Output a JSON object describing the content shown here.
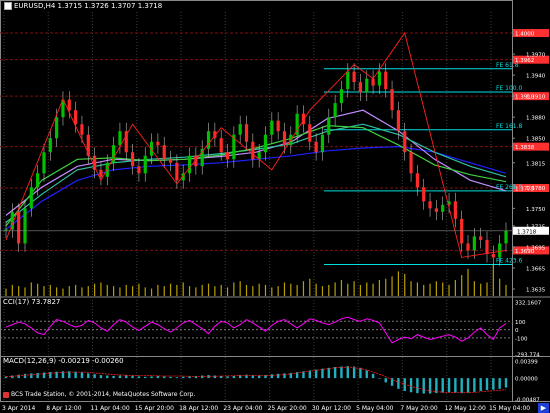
{
  "window": {
    "symbol_header": "EURUSD,H4  1.3715 1.3726 1.3707 1.3718",
    "footer": "BCS Trade Station, © 2001-2014, MetaQuotes Software Corp."
  },
  "icons": {
    "symbol_icon": "chart-icon",
    "footer_icon": "broker-logo-icon",
    "scroll_icon": "arrow-right-icon"
  },
  "colors": {
    "background": "#000000",
    "grid": "#3a3a3a",
    "candle_up": "#00c000",
    "candle_down": "#ff2a2a",
    "fib_lines": "#00e0e0",
    "zigzag": "#ff2020",
    "ma_blue": "#2020ff",
    "ma_violet": "#c08cff",
    "ma_teal": "#30c0a0",
    "ma_green": "#40d040",
    "ma_white": "#e0e0e0",
    "volume": "#b8a000",
    "cci_line": "#ff00ff",
    "macd_hist": "#20b0c0",
    "macd_signal": "#ff2020",
    "price_marker": "#ff3030",
    "current_price_bg": "#ffffff"
  },
  "chart_data": {
    "type": "candlestick",
    "symbol": "EURUSD",
    "timeframe": "H4",
    "ohlc_last": {
      "open": 1.3715,
      "high": 1.3726,
      "low": 1.3707,
      "close": 1.3718
    },
    "current_price": "1.3718",
    "price_axis_ticks": [
      "1.3970",
      "1.3940",
      "1.3910",
      "1.3880",
      "1.3850",
      "1.3815",
      "1.3780",
      "1.3750",
      "1.3725",
      "1.3695",
      "1.3665",
      "1.3635"
    ],
    "price_markers": [
      "1.4000",
      "1.3962",
      "1.3910",
      "1.3838",
      "1.3779",
      "1.3690"
    ],
    "ylim": [
      1.3625,
      1.403
    ],
    "x_ticks": [
      "3 Apr 2014",
      "8 Apr 12:00",
      "11 Apr 04:00",
      "15 Apr 20:00",
      "18 Apr 12:00",
      "23 Apr 04:00",
      "25 Apr 20:00",
      "30 Apr 12:00",
      "5 May 04:00",
      "7 May 20:00",
      "12 May 12:00",
      "15 May 04:00"
    ],
    "fib_levels": [
      {
        "label": "FE 61.8",
        "price": 1.3949
      },
      {
        "label": "FE 100.0",
        "price": 1.3916
      },
      {
        "label": "FE 161.8",
        "price": 1.3862
      },
      {
        "label": "FE 261.8",
        "price": 1.3775
      },
      {
        "label": "FE 423.6",
        "price": 1.367
      }
    ],
    "price_series": [
      1.372,
      1.3745,
      1.37,
      1.375,
      1.378,
      1.38,
      1.383,
      1.385,
      1.388,
      1.3905,
      1.389,
      1.387,
      1.3855,
      1.3825,
      1.3805,
      1.3795,
      1.3815,
      1.384,
      1.386,
      1.383,
      1.381,
      1.38,
      1.3825,
      1.3845,
      1.384,
      1.382,
      1.3815,
      1.379,
      1.38,
      1.3825,
      1.381,
      1.3835,
      1.386,
      1.385,
      1.383,
      1.382,
      1.3855,
      1.387,
      1.3845,
      1.382,
      1.383,
      1.3855,
      1.3875,
      1.386,
      1.384,
      1.3855,
      1.3885,
      1.387,
      1.3845,
      1.383,
      1.3855,
      1.388,
      1.39,
      1.392,
      1.3945,
      1.393,
      1.3915,
      1.3935,
      1.3925,
      1.3945,
      1.392,
      1.389,
      1.386,
      1.383,
      1.38,
      1.378,
      1.376,
      1.375,
      1.3745,
      1.3755,
      1.376,
      1.3735,
      1.37,
      1.369,
      1.371,
      1.3705,
      1.3685,
      1.368,
      1.37,
      1.3718
    ],
    "zigzag": [
      [
        0,
        1.3705
      ],
      [
        9,
        1.3906
      ],
      [
        15,
        1.379
      ],
      [
        20,
        1.387
      ],
      [
        27,
        1.3785
      ],
      [
        34,
        1.3865
      ],
      [
        42,
        1.3805
      ],
      [
        48,
        1.389
      ],
      [
        55,
        1.3955
      ],
      [
        58,
        1.3935
      ],
      [
        63,
        1.4
      ],
      [
        72,
        1.368
      ],
      [
        79,
        1.369
      ]
    ],
    "moving_averages": [
      {
        "color": "#2020ff",
        "values": [
          1.372,
          1.376,
          1.379,
          1.3805,
          1.381,
          1.3812,
          1.3815,
          1.382,
          1.3825,
          1.3832,
          1.3836,
          1.3838,
          1.383,
          1.3815,
          1.38
        ]
      },
      {
        "color": "#c08cff",
        "values": [
          1.374,
          1.378,
          1.381,
          1.382,
          1.3818,
          1.382,
          1.3824,
          1.383,
          1.3845,
          1.3878,
          1.389,
          1.386,
          1.382,
          1.379,
          1.3775
        ]
      },
      {
        "color": "#30c0a0",
        "values": [
          1.373,
          1.377,
          1.3805,
          1.3815,
          1.382,
          1.3823,
          1.3828,
          1.3834,
          1.3842,
          1.386,
          1.387,
          1.3855,
          1.383,
          1.381,
          1.3795
        ]
      },
      {
        "color": "#40d040",
        "values": [
          1.3725,
          1.379,
          1.382,
          1.3822,
          1.3818,
          1.382,
          1.3826,
          1.3836,
          1.385,
          1.3868,
          1.3865,
          1.384,
          1.3812,
          1.3798,
          1.3788
        ]
      }
    ],
    "volume": [
      6,
      9,
      8,
      7,
      11,
      10,
      8,
      9,
      7,
      6,
      8,
      9,
      7,
      8,
      10,
      11,
      9,
      8,
      7,
      9,
      8,
      10,
      7,
      6,
      9,
      8,
      10,
      9,
      11,
      8,
      7,
      9,
      10,
      8,
      9,
      7,
      11,
      12,
      9,
      8,
      10,
      9,
      7,
      8,
      11,
      10,
      9,
      12,
      14,
      10,
      8,
      9,
      11,
      13,
      10,
      12,
      9,
      11,
      10,
      13,
      14,
      16,
      20,
      18,
      12,
      11,
      9,
      10,
      12,
      11,
      9,
      13,
      17,
      22,
      12,
      10,
      11,
      26,
      14,
      9
    ],
    "cci": {
      "label": "CCI(17) 73.7827",
      "axis_ticks": [
        "332.1607",
        "100",
        "0",
        "-100",
        "-293.774"
      ],
      "values": [
        30,
        60,
        90,
        70,
        20,
        -40,
        -60,
        40,
        120,
        100,
        60,
        30,
        50,
        110,
        80,
        20,
        -20,
        60,
        120,
        90,
        30,
        -10,
        40,
        90,
        60,
        10,
        -30,
        20,
        80,
        110,
        60,
        10,
        -50,
        40,
        100,
        80,
        20,
        60,
        120,
        80,
        30,
        -20,
        50,
        100,
        120,
        70,
        20,
        70,
        130,
        110,
        80,
        60,
        90,
        130,
        150,
        120,
        100,
        130,
        110,
        80,
        -40,
        -160,
        -120,
        -90,
        -110,
        -60,
        -90,
        -120,
        -100,
        -80,
        -60,
        -90,
        -140,
        -100,
        -30,
        20,
        -60,
        -120,
        20,
        73
      ]
    },
    "macd": {
      "label": "MACD(12,26,9) -0.00219 -0.00260",
      "axis_ticks": [
        "0.00399",
        "0.00000",
        "-0.00487"
      ],
      "values": [
        0.0004,
        0.0006,
        0.0008,
        0.001,
        0.0011,
        0.0012,
        0.0013,
        0.0014,
        0.0015,
        0.0016,
        0.0016,
        0.0015,
        0.0013,
        0.0011,
        0.0009,
        0.0007,
        0.0006,
        0.0005,
        0.0006,
        0.0007,
        0.0006,
        0.0004,
        0.0003,
        0.0004,
        0.0005,
        0.0004,
        0.0003,
        0.0002,
        0.0003,
        0.0004,
        0.0005,
        0.0006,
        0.0007,
        0.0006,
        0.0005,
        0.0004,
        0.0005,
        0.0007,
        0.0008,
        0.0007,
        0.0006,
        0.0007,
        0.0009,
        0.001,
        0.0011,
        0.0012,
        0.0014,
        0.0016,
        0.0018,
        0.002,
        0.0022,
        0.0024,
        0.0026,
        0.0027,
        0.0028,
        0.0027,
        0.0024,
        0.0018,
        0.001,
        0.0,
        -0.001,
        -0.0018,
        -0.0025,
        -0.003,
        -0.0033,
        -0.0035,
        -0.0036,
        -0.0036,
        -0.0035,
        -0.0034,
        -0.0033,
        -0.0034,
        -0.0035,
        -0.0034,
        -0.0032,
        -0.003,
        -0.0028,
        -0.0027,
        -0.0025,
        -0.0022
      ],
      "signal": [
        0.0003,
        0.0006,
        0.0009,
        0.0012,
        0.0014,
        0.0014,
        0.0011,
        0.0008,
        0.0006,
        0.0006,
        0.0005,
        0.0005,
        0.0004,
        0.0004,
        0.0005,
        0.0006,
        0.0006,
        0.0006,
        0.0009,
        0.0014,
        0.0019,
        0.0024,
        0.0026,
        0.002,
        0.0008,
        -0.0008,
        -0.002,
        -0.0029,
        -0.0033,
        -0.0034,
        -0.0033,
        -0.003,
        -0.0027
      ]
    }
  }
}
